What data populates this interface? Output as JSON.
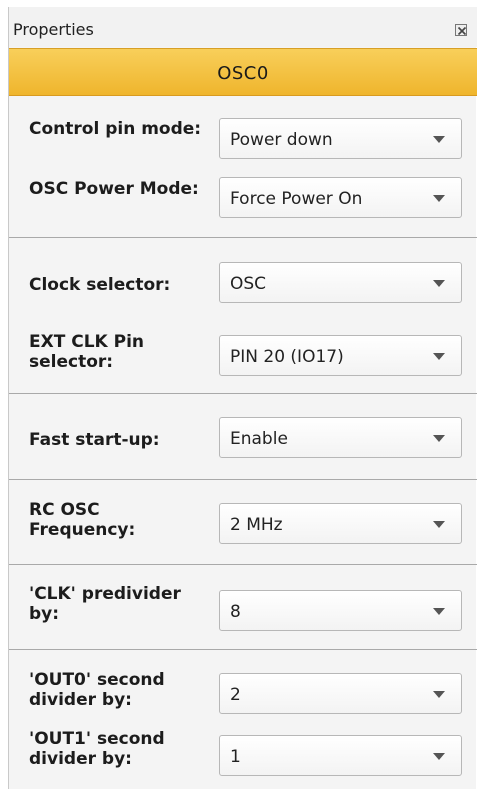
{
  "panel": {
    "title": "Properties",
    "header": "OSC0"
  },
  "fields": [
    {
      "label": "Control pin mode:",
      "value": "Power down"
    },
    {
      "label": "OSC Power Mode:",
      "value": "Force Power On"
    },
    {
      "label": "Clock selector:",
      "value": "OSC"
    },
    {
      "label": "EXT CLK Pin selector:",
      "value": "PIN 20 (IO17)"
    },
    {
      "label": "Fast start-up:",
      "value": "Enable"
    },
    {
      "label": "RC OSC Frequency:",
      "value": "2 MHz"
    },
    {
      "label": "'CLK' predivider by:",
      "value": "8"
    },
    {
      "label": "'OUT0' second divider by:",
      "value": "2"
    },
    {
      "label": "'OUT1' second divider by:",
      "value": "1"
    }
  ],
  "icons": {
    "close": "close-icon",
    "dropdown": "chevron-down-icon"
  },
  "colors": {
    "header_accent": "#f2c047",
    "panel_background": "#f4f4f4"
  }
}
